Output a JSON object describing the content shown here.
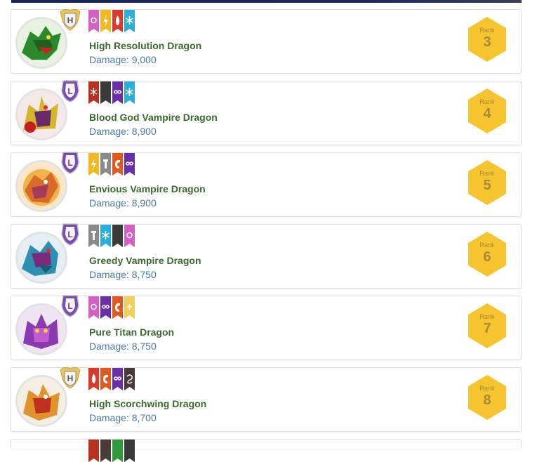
{
  "rank_label": "Rank",
  "damage_label": "Damage: ",
  "colors": {
    "name_text": "#3a6b2c",
    "damage_text": "#4a7ab0",
    "rank_badge": "#f5c42e",
    "legendary_badge": "#6c3fa0",
    "heroic_badge": "#e8c55a"
  },
  "entries": [
    {
      "name": "High Resolution Dragon",
      "damage": "9,000",
      "rank": "3",
      "rarity": "H",
      "elements": [
        "pure",
        "electric",
        "flame",
        "ice"
      ]
    },
    {
      "name": "Blood God Vampire Dragon",
      "damage": "8,900",
      "rank": "4",
      "rarity": "L",
      "elements": [
        "flame-rune",
        "dark",
        "legend",
        "ice"
      ]
    },
    {
      "name": "Envious Vampire Dragon",
      "damage": "8,900",
      "rank": "5",
      "rarity": "L",
      "elements": [
        "electric",
        "metal",
        "war",
        "legend"
      ]
    },
    {
      "name": "Greedy Vampire Dragon",
      "damage": "8,750",
      "rank": "6",
      "rarity": "L",
      "elements": [
        "metal",
        "ice",
        "dark",
        "pure"
      ]
    },
    {
      "name": "Pure Titan Dragon",
      "damage": "8,750",
      "rank": "7",
      "rarity": "L",
      "elements": [
        "pure",
        "legend",
        "war",
        "light"
      ]
    },
    {
      "name": "High Scorchwing Dragon",
      "damage": "8,700",
      "rank": "8",
      "rarity": "H",
      "elements": [
        "flame",
        "war",
        "legend",
        "wind"
      ]
    }
  ]
}
